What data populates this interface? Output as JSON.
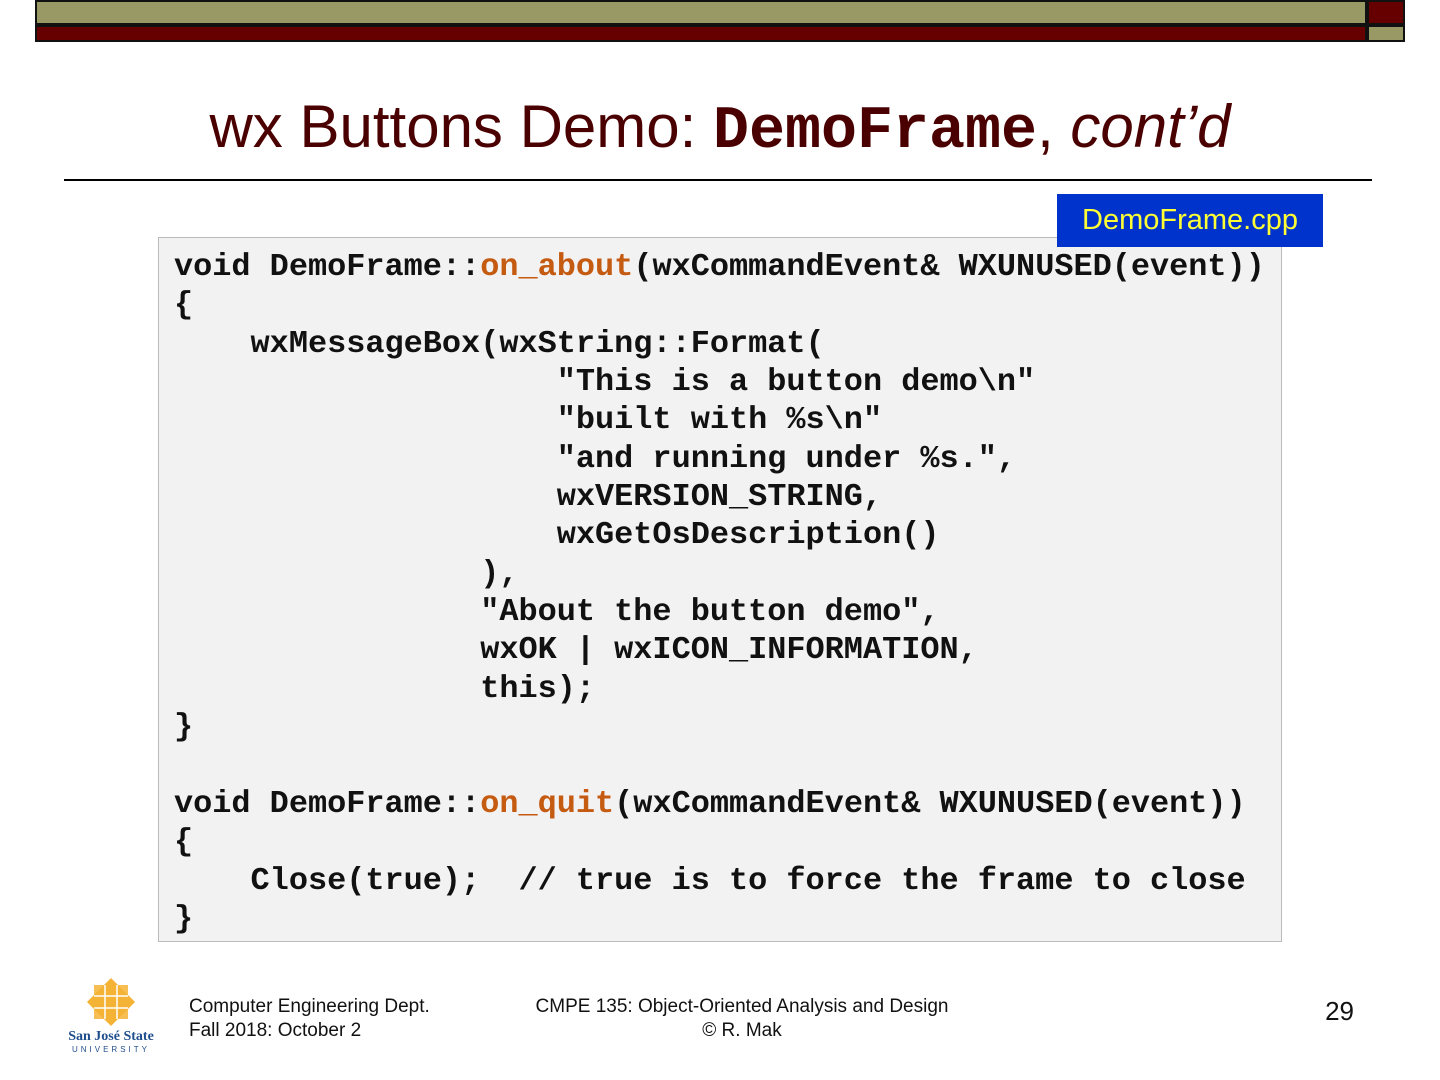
{
  "title": {
    "prefix": "wx Buttons Demo: ",
    "mono": "DemoFrame",
    "sep": ", ",
    "italic": "cont’d"
  },
  "file_tag": "DemoFrame.cpp",
  "code": {
    "l1a": "void DemoFrame::",
    "l1b": "on_about",
    "l1c": "(wxCommandEvent& WXUNUSED(event))",
    "body1": "{\n    wxMessageBox(wxString::Format(\n                    \"This is a button demo\\n\"\n                    \"built with %s\\n\"\n                    \"and running under %s.\",\n                    wxVERSION_STRING,\n                    wxGetOsDescription()\n                ),\n                \"About the button demo\",\n                wxOK | wxICON_INFORMATION,\n                this);\n}\n",
    "l2a": "void DemoFrame::",
    "l2b": "on_quit",
    "l2c": "(wxCommandEvent& WXUNUSED(event))",
    "body2": "{\n    Close(true);  // true is to force the frame to close\n}"
  },
  "footer": {
    "logo_text": "San José State UNIVERSITY",
    "dept": "Computer Engineering Dept.",
    "date": "Fall 2018: October 2",
    "course": "CMPE 135: Object-Oriented Analysis and Design",
    "author": "© R. Mak",
    "page": "29"
  },
  "colors": {
    "olive": "#999966",
    "maroon": "#660000",
    "highlight": "#c55a11",
    "tag_bg": "#0033cc",
    "tag_fg": "#ffff33"
  }
}
